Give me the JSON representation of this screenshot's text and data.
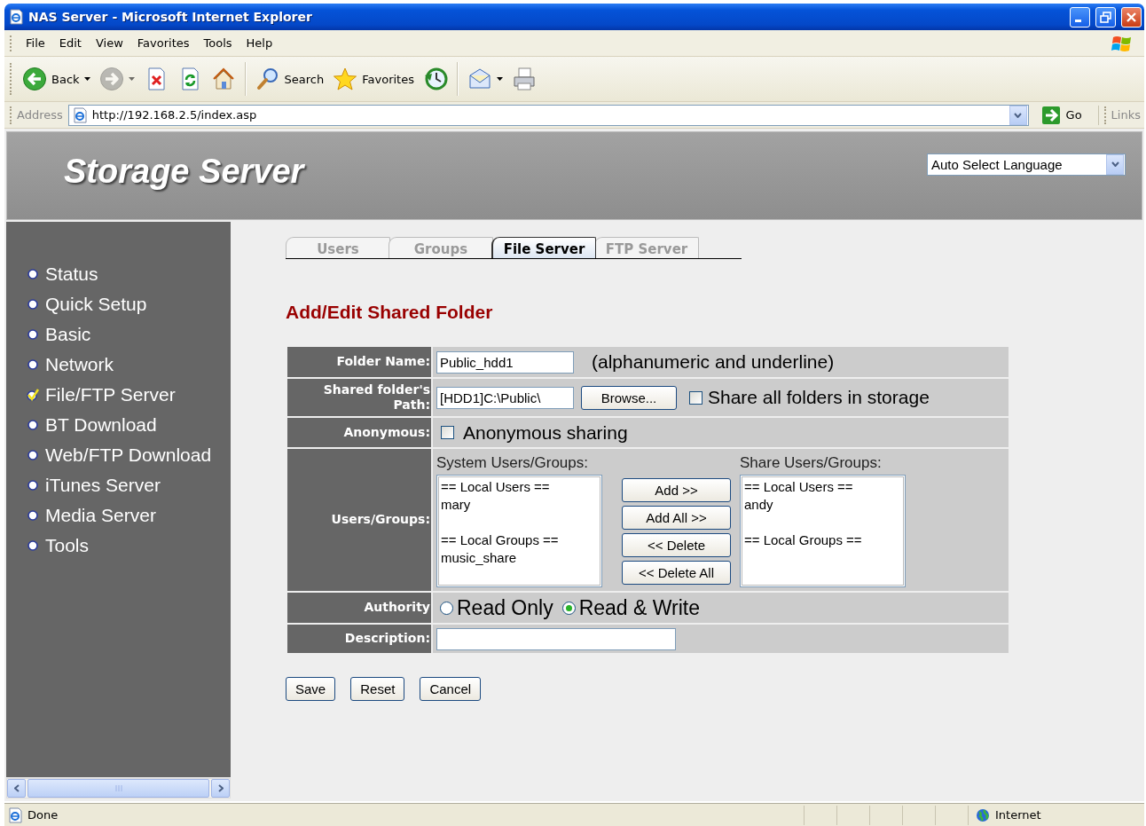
{
  "window": {
    "title": "NAS Server - Microsoft Internet Explorer"
  },
  "menu_bar": [
    "File",
    "Edit",
    "View",
    "Favorites",
    "Tools",
    "Help"
  ],
  "toolbar": [
    {
      "kind": "back",
      "label": "Back",
      "disabled": false,
      "menu": true
    },
    {
      "kind": "forward",
      "disabled": true,
      "menu": true
    },
    {
      "kind": "stop",
      "disabled": false,
      "menu": false
    },
    {
      "kind": "refresh",
      "disabled": false,
      "menu": false
    },
    {
      "kind": "home",
      "disabled": false,
      "menu": false
    },
    {
      "kind": "search",
      "label": "Search",
      "disabled": false,
      "menu": false
    },
    {
      "kind": "favorites",
      "label": "Favorites",
      "disabled": false,
      "menu": false
    },
    {
      "kind": "history",
      "disabled": false,
      "menu": false
    },
    {
      "kind": "mail",
      "disabled": false,
      "menu": true
    },
    {
      "kind": "print",
      "disabled": false,
      "menu": false
    }
  ],
  "address_bar": {
    "label": "Address",
    "url": "http://192.168.2.5/index.asp",
    "go": "Go",
    "links": "Links"
  },
  "page": {
    "header": {
      "title": "Storage Server",
      "language": "Auto Select Language"
    },
    "sidebar": {
      "items": [
        {
          "label": "Status",
          "selected": false
        },
        {
          "label": "Quick Setup",
          "selected": false
        },
        {
          "label": "Basic",
          "selected": false
        },
        {
          "label": "Network",
          "selected": false
        },
        {
          "label": "File/FTP Server",
          "selected": true
        },
        {
          "label": "BT Download",
          "selected": false
        },
        {
          "label": "Web/FTP Download",
          "selected": false
        },
        {
          "label": "iTunes Server",
          "selected": false
        },
        {
          "label": "Media Server",
          "selected": false
        },
        {
          "label": "Tools",
          "selected": false
        }
      ]
    },
    "tabs": [
      {
        "label": "Users",
        "selected": false
      },
      {
        "label": "Groups",
        "selected": false
      },
      {
        "label": "File Server",
        "selected": true
      },
      {
        "label": "FTP Server",
        "selected": false
      }
    ],
    "heading": "Add/Edit Shared Folder",
    "form": {
      "folder_name": {
        "label": "Folder Name:",
        "value": "Public_hdd1",
        "hint": "(alphanumeric and underline)"
      },
      "path": {
        "label": "Shared folder's Path:",
        "value": "[HDD1]C:\\Public\\",
        "button": "Browse...",
        "checkbox": {
          "label": "Share all folders in storage",
          "checked": false
        }
      },
      "anonymous": {
        "label": "Anonymous:",
        "checkbox": {
          "label": "Anonymous sharing",
          "checked": false
        }
      },
      "users_groups": {
        "label": "Users/Groups:",
        "system": {
          "title": "System Users/Groups:",
          "items": [
            {
              "kind": "header",
              "text": "== Local Users =="
            },
            {
              "kind": "entry",
              "text": "mary"
            },
            {
              "kind": "header",
              "text": "== Local Groups =="
            },
            {
              "kind": "entry",
              "text": "music_share"
            }
          ]
        },
        "buttons": [
          "Add >>",
          "Add All >>",
          "<< Delete",
          "<< Delete All"
        ],
        "share": {
          "title": "Share Users/Groups:",
          "items": [
            {
              "kind": "header",
              "text": "== Local Users =="
            },
            {
              "kind": "entry",
              "text": "andy"
            },
            {
              "kind": "header",
              "text": "== Local Groups =="
            }
          ]
        }
      },
      "authority": {
        "label": "Authority",
        "options": [
          {
            "label": "Read Only",
            "selected": false
          },
          {
            "label": "Read & Write",
            "selected": true
          }
        ]
      },
      "description": {
        "label": "Description:"
      }
    },
    "actions": [
      "Save",
      "Reset",
      "Cancel"
    ]
  },
  "status_bar": {
    "text": "Done",
    "zone": "Internet"
  }
}
